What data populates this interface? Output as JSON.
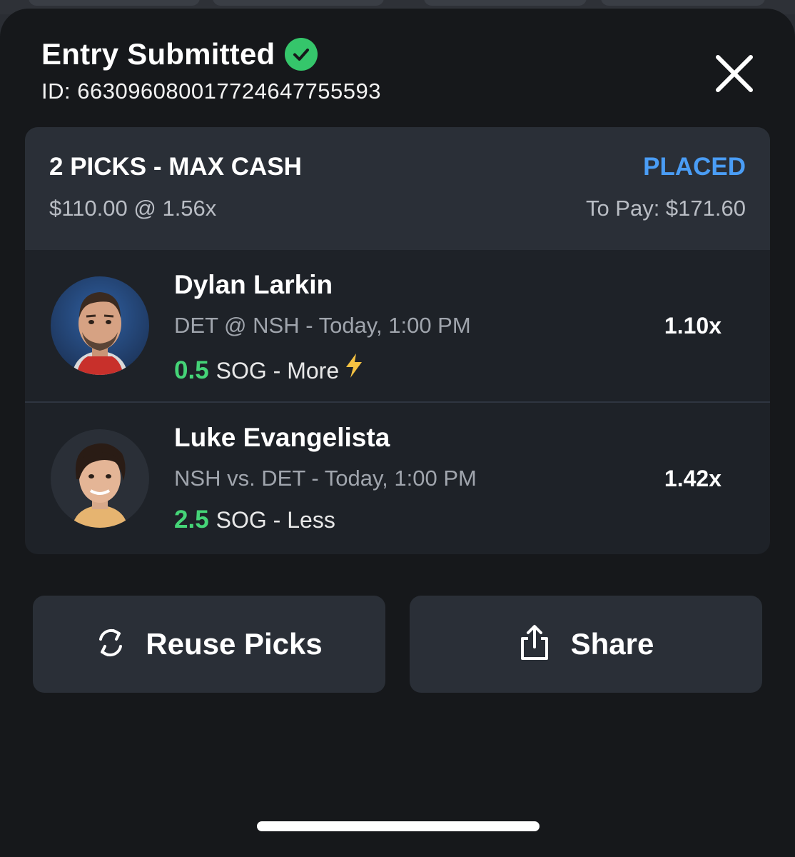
{
  "header": {
    "title": "Entry Submitted",
    "entry_id": "ID: 663096080017724647755593"
  },
  "entry": {
    "type": "2 PICKS - MAX CASH",
    "status": "PLACED",
    "stake": "$110.00 @ 1.56x",
    "to_pay": "To Pay: $171.60"
  },
  "picks": [
    {
      "player": "Dylan Larkin",
      "game": "DET @ NSH  - Today, 1:00 PM",
      "line_value": "0.5",
      "line_desc": "SOG - More",
      "multiplier": "1.10x"
    },
    {
      "player": "Luke Evangelista",
      "game": "NSH vs. DET  - Today, 1:00 PM",
      "line_value": "2.5",
      "line_desc": "SOG - Less",
      "multiplier": "1.42x"
    }
  ],
  "actions": {
    "reuse_label": "Reuse Picks",
    "share_label": "Share"
  },
  "colors": {
    "placed_blue": "#4a9df5",
    "line_green": "#45d477",
    "check_green": "#35c66b",
    "sheet_bg": "#16181b"
  }
}
